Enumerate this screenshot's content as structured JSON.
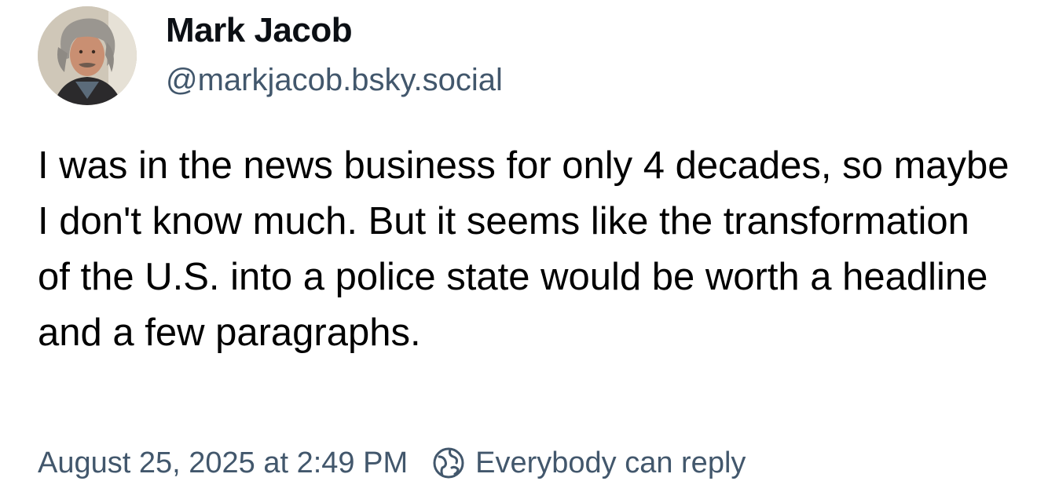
{
  "post": {
    "author": {
      "display_name": "Mark Jacob",
      "handle": "@markjacob.bsky.social",
      "avatar_icon": "avatar-photo"
    },
    "text": "I was in the news business for only 4 decades, so maybe I don't know much. But it seems like the transformation of the U.S. into a police state would be worth a headline and a few paragraphs.",
    "timestamp": "August 25, 2025 at 2:49 PM",
    "reply_setting": {
      "icon": "earth-globe-icon",
      "label": "Everybody can reply"
    }
  },
  "colors": {
    "text": "#000000",
    "secondary_text": "#42576c",
    "background": "#ffffff"
  }
}
